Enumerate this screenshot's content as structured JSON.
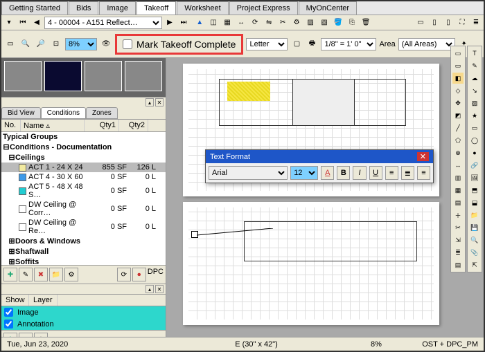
{
  "tabs": [
    "Getting Started",
    "Bids",
    "Image",
    "Takeoff",
    "Worksheet",
    "Project Express",
    "MyOnCenter"
  ],
  "active_tab": 3,
  "nav": {
    "page_label": "4 - 00004 - A151 Reflect…"
  },
  "toolbar2": {
    "zoom": "8%",
    "mark_complete": "Mark Takeoff Complete",
    "paper": "Letter",
    "scale": "1/8\" = 1' 0\"",
    "area_label": "Area",
    "area_value": "(All Areas)"
  },
  "subtabs": [
    "Bid View",
    "Conditions",
    "Zones"
  ],
  "active_subtab": 1,
  "tree_cols": {
    "no": "No.",
    "name": "Name",
    "q1": "Qty1",
    "q2": "Qty2"
  },
  "tree": {
    "typical": "Typical Groups",
    "conditions_doc": "Conditions - Documentation",
    "ceilings": "Ceilings",
    "rows": [
      {
        "swatch": "#f2eaa0",
        "name": "ACT 1 - 24 X 24",
        "q1": "855 SF",
        "q2": "126 L",
        "sel": true
      },
      {
        "swatch": "#3e9ae8",
        "name": "ACT 4 - 30 X 60",
        "q1": "0 SF",
        "q2": "0 L"
      },
      {
        "swatch": "#21ccd1",
        "name": "ACT 5 - 48 X 48 S…",
        "q1": "0 SF",
        "q2": "0 L"
      },
      {
        "swatch": "#ffffff",
        "name": "DW Ceiling @ Corr…",
        "q1": "0 SF",
        "q2": "0 L"
      },
      {
        "swatch": "#ffffff",
        "name": "DW Ceiling @ Re…",
        "q1": "0 SF",
        "q2": "0 L"
      }
    ],
    "doors": "Doors & Windows",
    "shaft": "Shaftwall",
    "soffits": "Soffits"
  },
  "dpc_label": "DPC",
  "layers": {
    "show": "Show",
    "layer": "Layer",
    "rows": [
      "Image",
      "Annotation"
    ]
  },
  "text_format": {
    "title": "Text Format",
    "font": "Arial",
    "size": "12"
  },
  "status": {
    "date": "Tue, Jun 23, 2020",
    "paper": "E (30\" x 42\")",
    "zoom": "8%",
    "db": "OST + DPC_PM"
  }
}
